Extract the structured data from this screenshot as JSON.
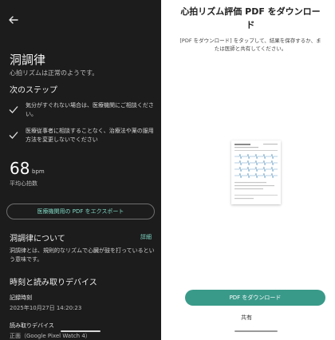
{
  "left": {
    "title": "洞調律",
    "subtitle": "心拍リズムは正常のようです。",
    "next_steps_heading": "次のステップ",
    "steps": [
      "気分がすぐれない場合は、医療機関にご相談ください。",
      "医療従事者に相談することなく、治療法や薬の服用方法を変更しないでください"
    ],
    "bpm_value": "68",
    "bpm_unit": "bpm",
    "bpm_label": "平均心拍数",
    "export_button": "医療機関用の PDF をエクスポート",
    "about_heading": "洞調律について",
    "detail_link": "詳細",
    "about_text": "洞調律とは、規則的なリズムで心臓が鼓を打っているという意味です。",
    "time_device_heading": "時刻と読み取りデバイス",
    "record_time_label": "記録時刻",
    "record_time_value": "2025年10月27日 14:20:23",
    "device_label": "読み取りデバイス",
    "device_value": "正面（Google Pixel Watch 4）"
  },
  "right": {
    "title": "心拍リズム評価 PDF をダウンロード",
    "description": "[PDF をダウンロード] をタップして、結果を保存するか、または医師と共有してください。",
    "download_button": "PDF をダウンロード",
    "share_button": "共有"
  },
  "colors": {
    "dark_bg": "#1c1c1c",
    "accent": "#3a9a8a",
    "accent_text": "#7fd9c4"
  }
}
